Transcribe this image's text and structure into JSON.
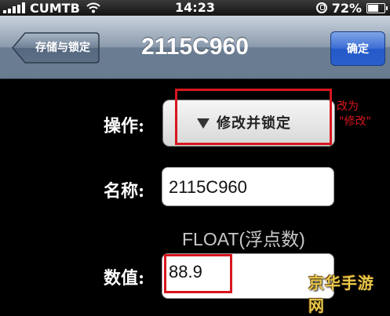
{
  "status_bar": {
    "carrier": "CUMTB",
    "time": "14:23",
    "battery_percent": "72%",
    "battery_level": 0.72
  },
  "nav": {
    "back_label": "存储与锁定",
    "title": "2115C960",
    "confirm_label": "确定"
  },
  "form": {
    "operation": {
      "label": "操作:",
      "value": "修改并锁定"
    },
    "name": {
      "label": "名称:",
      "value": "2115C960"
    },
    "type_label": "FLOAT(浮点数)",
    "value": {
      "label": "数值:",
      "value": "88.9"
    }
  },
  "annotation": {
    "line1": "改为",
    "line2": "\"修改\""
  },
  "watermark": "京华手游网",
  "colors": {
    "highlight": "#d8161d",
    "nav_button_blue": "#2a5fcc"
  }
}
